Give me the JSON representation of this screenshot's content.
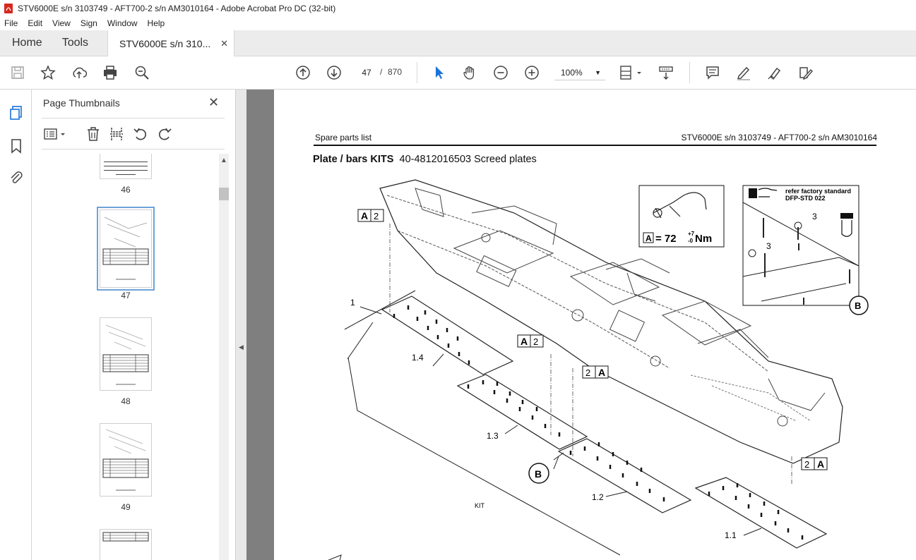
{
  "window": {
    "title": "STV6000E s/n 3103749 - AFT700-2 s/n AM3010164 - Adobe Acrobat Pro DC (32-bit)",
    "app_icon": "acrobat-icon"
  },
  "menu": [
    "File",
    "Edit",
    "View",
    "Sign",
    "Window",
    "Help"
  ],
  "tabs": {
    "home": "Home",
    "tools": "Tools",
    "document": "STV6000E s/n 310...",
    "close": "✕"
  },
  "toolbar": {
    "current_page": "47",
    "page_separator": "/",
    "total_pages": "870",
    "zoom": "100%"
  },
  "panel": {
    "title": "Page Thumbnails",
    "close": "✕",
    "thumbnails": [
      {
        "label": "46"
      },
      {
        "label": "47",
        "selected": true
      },
      {
        "label": "48"
      },
      {
        "label": "49"
      }
    ]
  },
  "document": {
    "header_left": "Spare parts list",
    "header_right": "STV6000E s/n 3103749 - AFT700-2 s/n AM3010164",
    "section_bold": "Plate / bars KITS",
    "section_rest": "40-4812016503 Screed plates",
    "callouts": {
      "a_label": "A",
      "two": "2",
      "b_label": "B",
      "torque": "= 72",
      "torque_sup": "+7",
      "torque_sub": "-0",
      "torque_unit": "Nm",
      "factory_line1": "refer factory standard",
      "factory_line2": "DFP-STD 022",
      "three": "3",
      "item_1": "1",
      "item_11": "1.1",
      "item_12": "1.2",
      "item_13": "1.3",
      "item_14": "1.4",
      "kit": "KIT"
    }
  }
}
